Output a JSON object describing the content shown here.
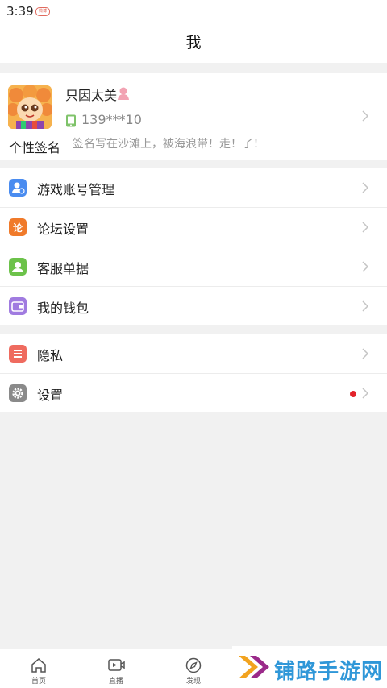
{
  "status_bar": {
    "time": "3:39",
    "app_badge": "微博"
  },
  "header": {
    "title": "我"
  },
  "profile": {
    "nickname": "只因太美",
    "phone": "139***10",
    "signature_label": "个性签名",
    "signature": "签名写在沙滩上，被海浪带！走！了！"
  },
  "menu_group_1": [
    {
      "label": "游戏账号管理",
      "icon": "account-manage-icon",
      "color": "#4a8cf0"
    },
    {
      "label": "论坛设置",
      "icon": "forum-settings-icon",
      "color": "#f07a2a"
    },
    {
      "label": "客服单据",
      "icon": "customer-service-icon",
      "color": "#6cc24a"
    },
    {
      "label": "我的钱包",
      "icon": "wallet-icon",
      "color": "#a07be0"
    }
  ],
  "menu_group_2": [
    {
      "label": "隐私",
      "icon": "privacy-icon",
      "color": "#ef6b5f"
    },
    {
      "label": "设置",
      "icon": "gear-icon",
      "color": "#8a8a8a",
      "has_badge": true
    }
  ],
  "bottom_nav": [
    {
      "label": "首页",
      "icon": "home-icon"
    },
    {
      "label": "直播",
      "icon": "live-icon"
    },
    {
      "label": "发现",
      "icon": "discover-icon"
    }
  ],
  "watermark": {
    "text": "铺路手游网"
  }
}
